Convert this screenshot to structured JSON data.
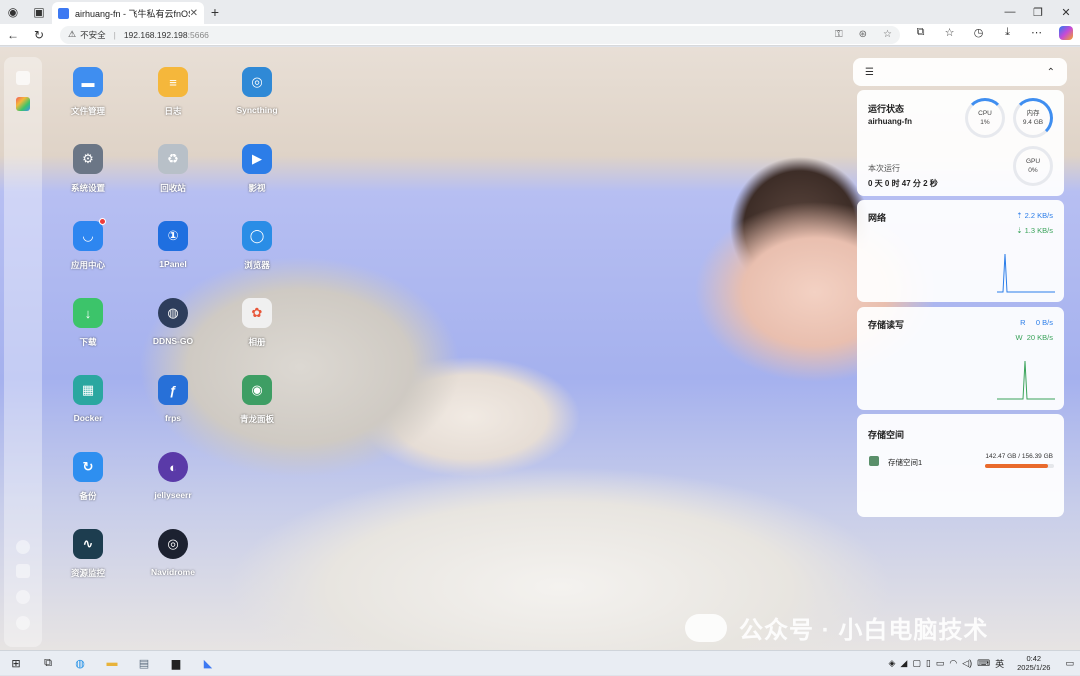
{
  "browser": {
    "tab_title": "airhuang-fn - 飞牛私有云fnOS",
    "insecure_label": "不安全",
    "url_host": "192.168.192.198",
    "url_port": ":5666"
  },
  "desktop": {
    "apps": [
      {
        "label": "文件管理",
        "icon": "folder-icon",
        "color": "#3f8ef0"
      },
      {
        "label": "日志",
        "icon": "log-icon",
        "color": "#f5b73b"
      },
      {
        "label": "Syncthing",
        "icon": "syncthing-icon",
        "color": "#2f89d6"
      },
      {
        "label": "系统设置",
        "icon": "settings-icon",
        "color": "#6b7686"
      },
      {
        "label": "回收站",
        "icon": "recycle-bin-icon",
        "color": "#b8c0c8"
      },
      {
        "label": "影视",
        "icon": "video-icon",
        "color": "#2c7de8"
      },
      {
        "label": "应用中心",
        "icon": "app-store-icon",
        "color": "#2d86f0"
      },
      {
        "label": "1Panel",
        "icon": "1panel-icon",
        "color": "#1f6fe0"
      },
      {
        "label": "浏览器",
        "icon": "browser-icon",
        "color": "#2a8de6"
      },
      {
        "label": "下载",
        "icon": "download-icon",
        "color": "#3cc46a"
      },
      {
        "label": "DDNS-GO",
        "icon": "ddns-icon",
        "color": "#2d3d5c"
      },
      {
        "label": "相册",
        "icon": "photos-icon",
        "color": "#f0f0f0"
      },
      {
        "label": "Docker",
        "icon": "docker-icon",
        "color": "#2aa7a0"
      },
      {
        "label": "frps",
        "icon": "frps-icon",
        "color": "#2770d8"
      },
      {
        "label": "青龙面板",
        "icon": "qinglong-icon",
        "color": "#3e9e64"
      },
      {
        "label": "备份",
        "icon": "backup-icon",
        "color": "#2e8ff0"
      },
      {
        "label": "jellyseerr",
        "icon": "jellyseerr-icon",
        "color": "#5a3aa8"
      },
      {
        "label": "资源监控",
        "icon": "monitor-icon",
        "color": "#1d3d4f"
      },
      {
        "label": "Navidrome",
        "icon": "navidrome-icon",
        "color": "#1c2130"
      }
    ]
  },
  "widgets": {
    "status": {
      "title": "运行状态",
      "hostname": "airhuang-fn",
      "uptime_label": "本次运行",
      "uptime_value": "0 天 0 时 47 分 2 秒",
      "cpu_label": "CPU",
      "cpu_value": "1%",
      "mem_label": "内存",
      "mem_value": "9.4 GB",
      "gpu_label": "GPU",
      "gpu_value": "0%"
    },
    "network": {
      "title": "网络",
      "up": "2.2 KB/s",
      "down": "1.3 KB/s"
    },
    "storage_io": {
      "title": "存储读写",
      "read_label": "R",
      "read_value": "0 B/s",
      "write_label": "W",
      "write_value": "20 KB/s"
    },
    "storage_space": {
      "title": "存储空间",
      "volume_name": "存储空间1",
      "usage": "142.47 GB / 156.39 GB",
      "usage_fraction": 0.911
    }
  },
  "watermark": "公众号 · 小白电脑技术",
  "taskbar": {
    "time": "0:42",
    "date": "2025/1/26",
    "ime": "英"
  }
}
